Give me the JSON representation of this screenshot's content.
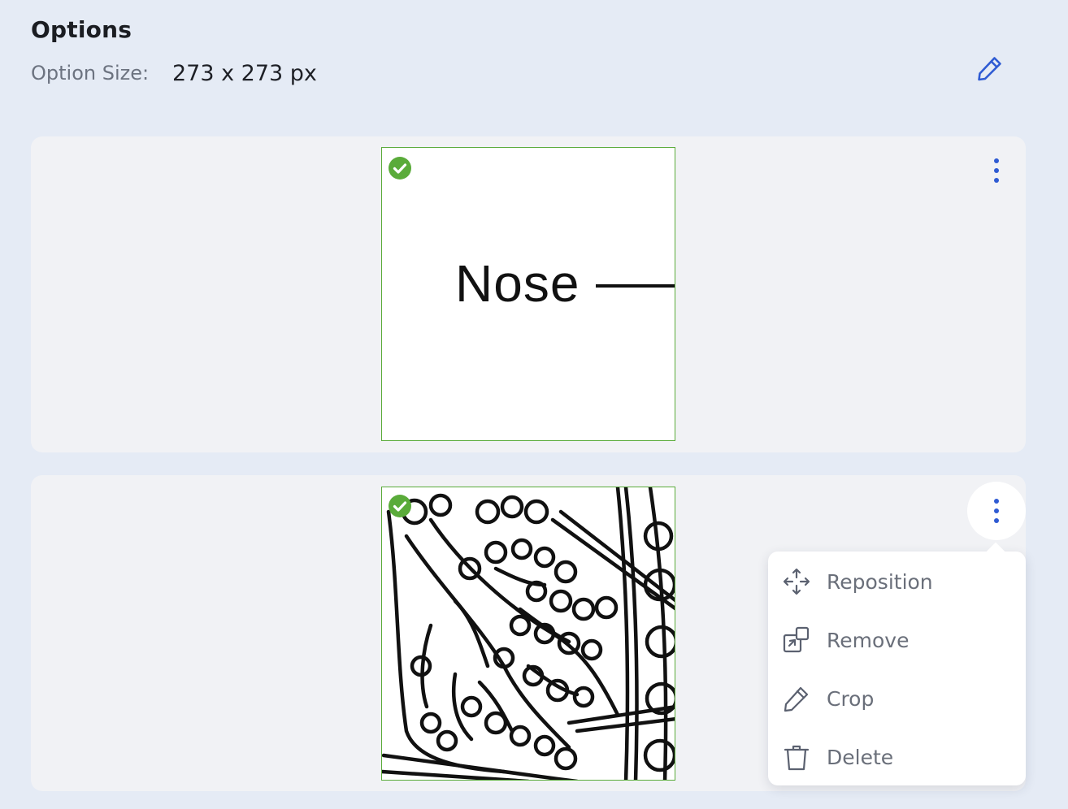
{
  "header": {
    "title": "Options",
    "size_label": "Option Size:",
    "size_value": "273 x 273 px"
  },
  "options": [
    {
      "image_text": "Nose",
      "selected": true
    },
    {
      "image_text": "",
      "selected": true
    }
  ],
  "menu": {
    "items": [
      {
        "label": "Reposition",
        "icon": "move-icon"
      },
      {
        "label": "Remove",
        "icon": "remove-image-icon"
      },
      {
        "label": "Crop",
        "icon": "pencil-icon"
      },
      {
        "label": "Delete",
        "icon": "trash-icon"
      }
    ]
  },
  "colors": {
    "background": "#e5ebf5",
    "card": "#f1f2f5",
    "accent": "#2f5bd3",
    "check": "#5aab3a"
  }
}
